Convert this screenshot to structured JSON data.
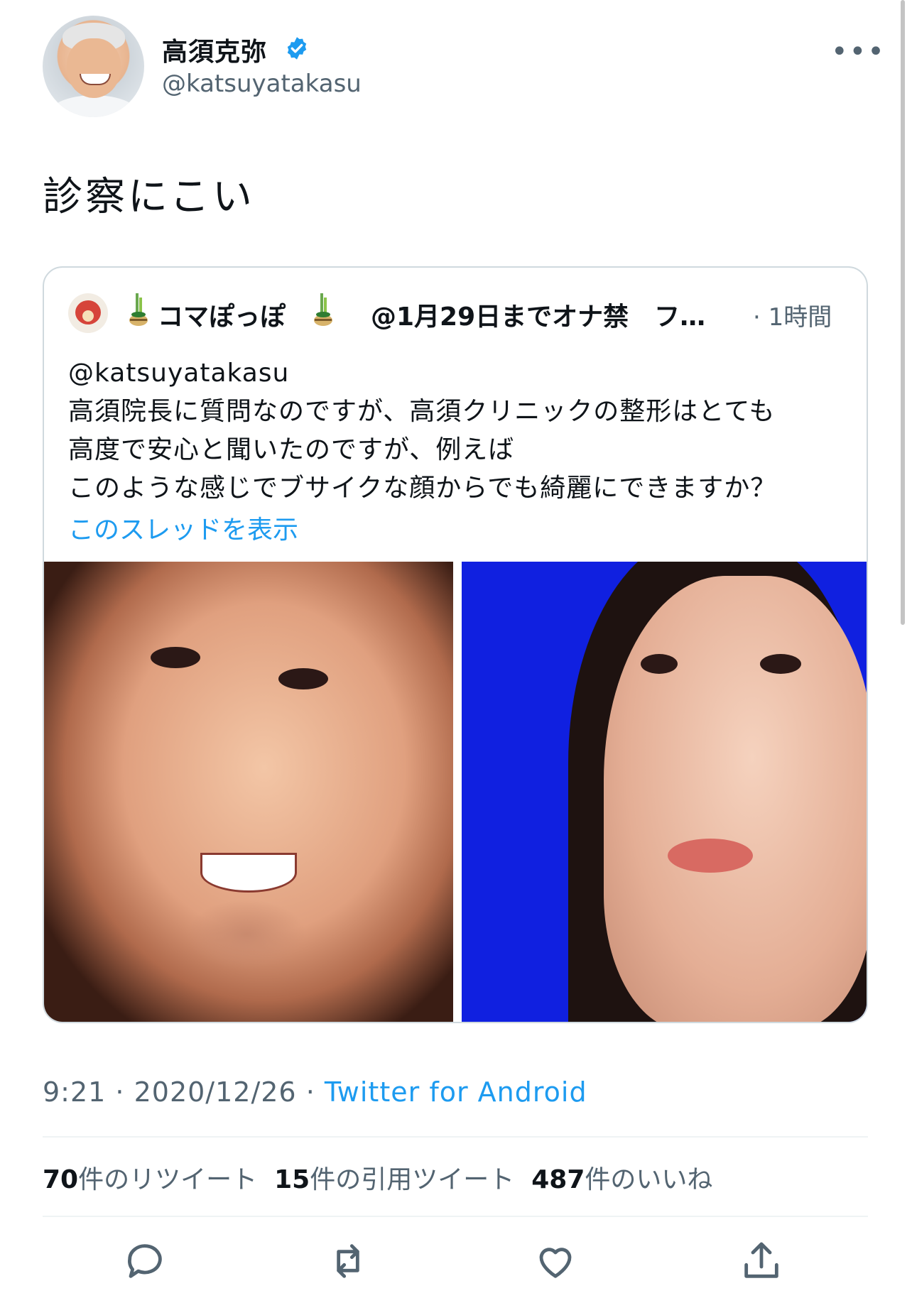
{
  "author": {
    "name": "高須克弥",
    "handle": "@katsuyatakasu",
    "avatar": "avatar-icon",
    "verified": true
  },
  "tweet": {
    "text": "診察にこい",
    "time": "9:21",
    "date": "2020/12/26",
    "separator": " · ",
    "source": "Twitter for Android"
  },
  "quote": {
    "name": "コマぽっぽ",
    "handle": "@1月29日までオナ禁　フ…",
    "time": "· 1時間",
    "lines": [
      "@katsuyatakasu",
      "高須院長に質問なのですが、高須クリニックの整形はとても",
      "高度で安心と聞いたのですが、例えば",
      "このような感じでブサイクな顔からでも綺麗にできますか？"
    ],
    "thread_link": "このスレッドを表示"
  },
  "stats": [
    {
      "count": "70",
      "label": "件のリツイート"
    },
    {
      "count": "15",
      "label": "件の引用ツイート"
    },
    {
      "count": "487",
      "label": "件のいいね"
    }
  ],
  "actions": [
    "reply-icon",
    "retweet-icon",
    "like-icon",
    "share-icon"
  ],
  "colors": {
    "link": "#1d9bf0",
    "secondary_text": "#536471",
    "verified": "#1d9bf0",
    "image_background": "#1020e0"
  }
}
